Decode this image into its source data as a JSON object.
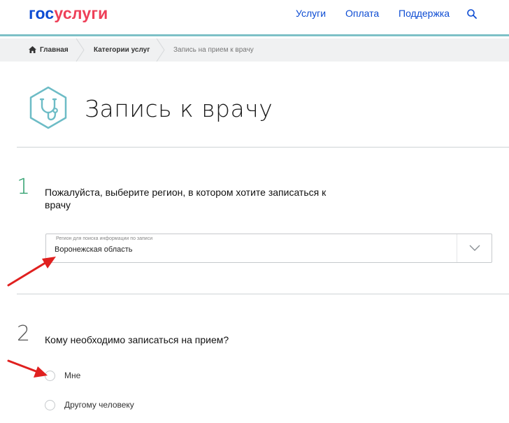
{
  "header": {
    "logo_part1": "гос",
    "logo_part2": "услуги",
    "nav": [
      "Услуги",
      "Оплата",
      "Поддержка"
    ]
  },
  "breadcrumb": {
    "home": "Главная",
    "category": "Категории услуг",
    "current": "Запись на прием к врачу"
  },
  "page": {
    "title": "Запись к врачу",
    "icon": "stethoscope-icon"
  },
  "step1": {
    "number": "1",
    "text": "Пожалуйста, выберите регион, в котором хотите записаться к врачу",
    "select_label": "Регион для поиска информации по записи",
    "select_value": "Воронежская область"
  },
  "step2": {
    "number": "2",
    "text": "Кому необходимо записаться на прием?",
    "options": [
      "Мне",
      "Другому человеку"
    ]
  },
  "colors": {
    "brand_blue": "#0d4cd3",
    "brand_red": "#ee3f58",
    "accent_teal": "#7dc0c7",
    "step_green": "#2a9d6a",
    "annotation_red": "#e0201f"
  }
}
